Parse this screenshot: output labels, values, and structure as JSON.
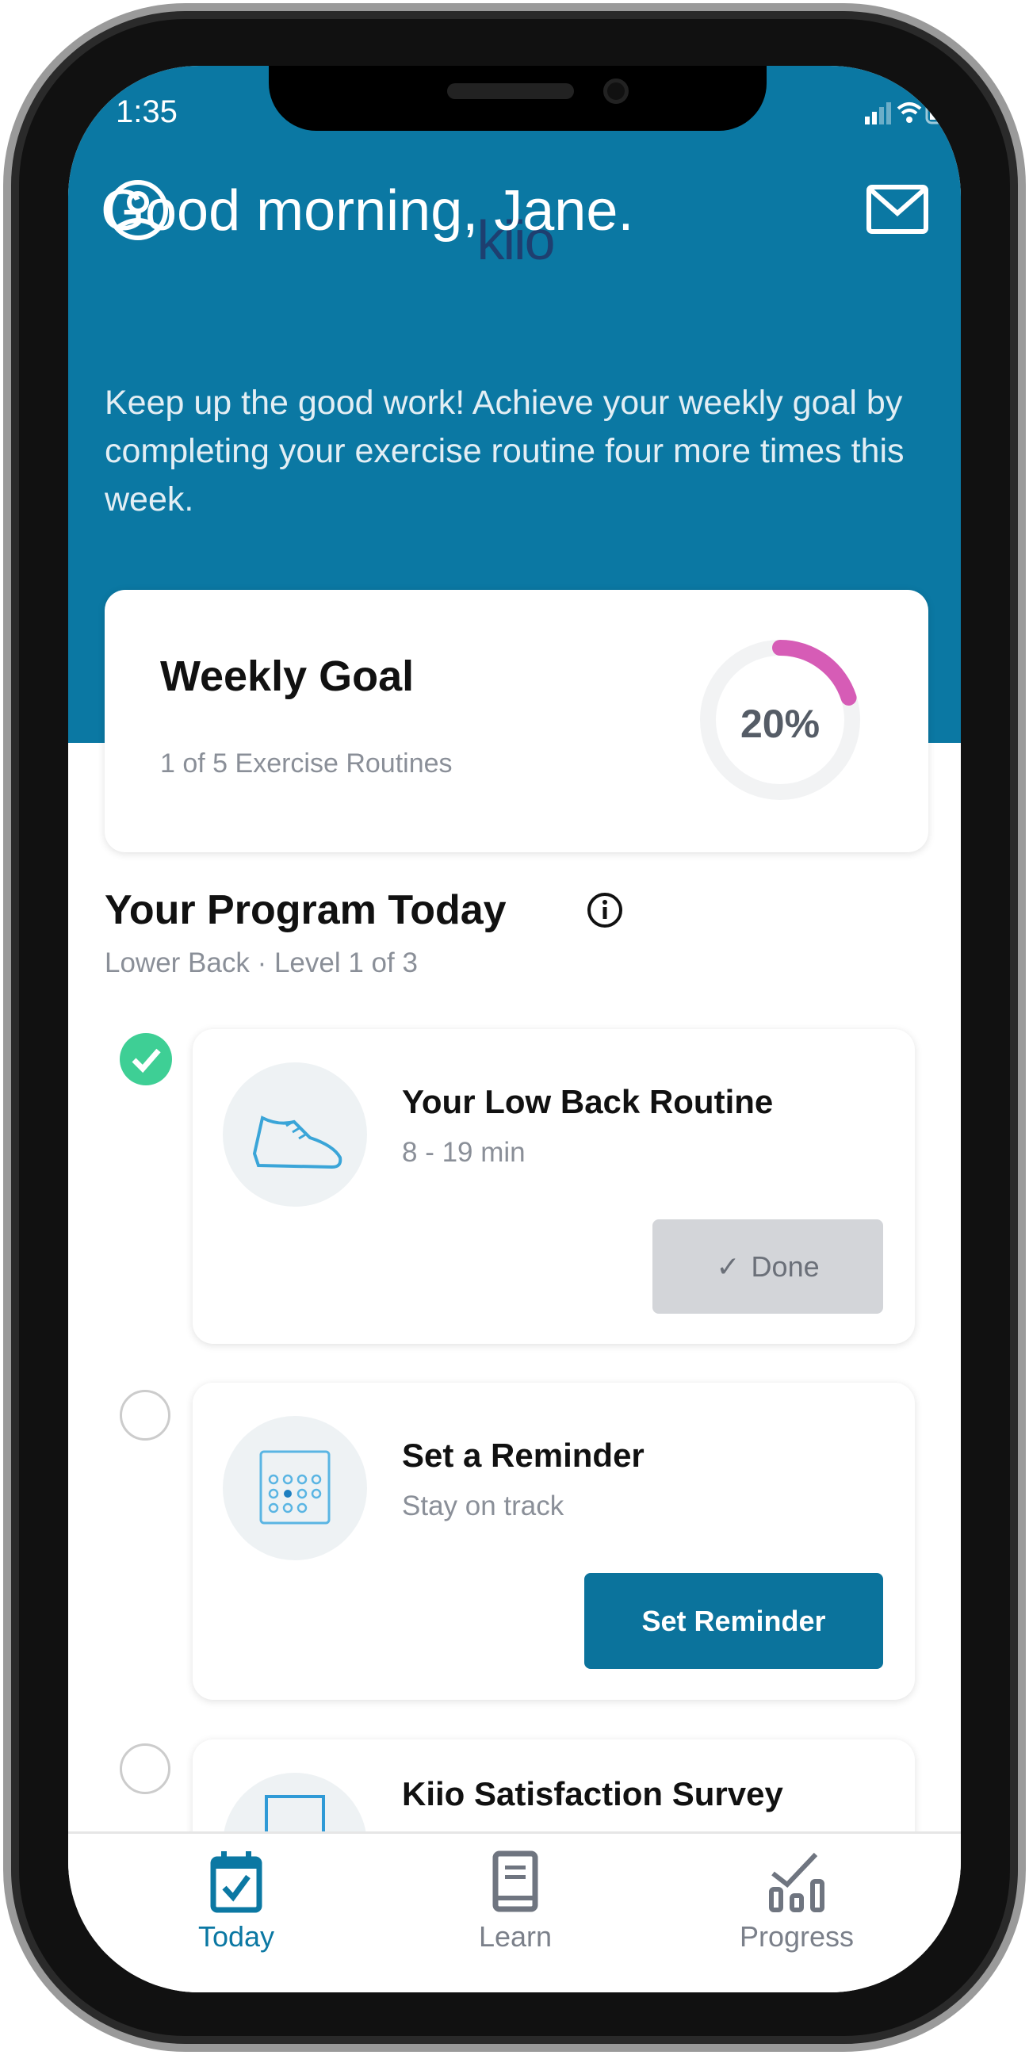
{
  "status_bar": {
    "time": "1:35"
  },
  "header": {
    "logo": "kiio",
    "profile_icon": "user-circle-icon",
    "mail_icon": "mail-icon"
  },
  "greeting": {
    "title": "Good morning, Jane.",
    "message": "Keep up the good work! Achieve your weekly goal by completing your exercise routine four more times this week."
  },
  "weekly_goal": {
    "title": "Weekly Goal",
    "subtitle": "1 of 5 Exercise Routines",
    "percent_label": "20%",
    "progress": 0.2,
    "ring_color": "#d65cb6"
  },
  "program": {
    "title": "Your Program Today",
    "subtitle": "Lower Back · Level 1 of 3",
    "items": [
      {
        "title": "Your Low Back Routine",
        "subtitle": "8 - 19 min",
        "button": "Done",
        "completed": true,
        "icon": "sneaker-icon"
      },
      {
        "title": "Set a Reminder",
        "subtitle": "Stay on track",
        "button": "Set Reminder",
        "completed": false,
        "icon": "calendar-icon"
      },
      {
        "title": "Kiio Satisfaction Survey",
        "completed": false,
        "icon": "clipboard-icon"
      }
    ]
  },
  "tabs": [
    {
      "label": "Today",
      "active": true
    },
    {
      "label": "Learn",
      "active": false
    },
    {
      "label": "Progress",
      "active": false
    }
  ],
  "colors": {
    "primary": "#0b78a3",
    "success": "#3ecf95",
    "logo": "#1e3f70"
  }
}
